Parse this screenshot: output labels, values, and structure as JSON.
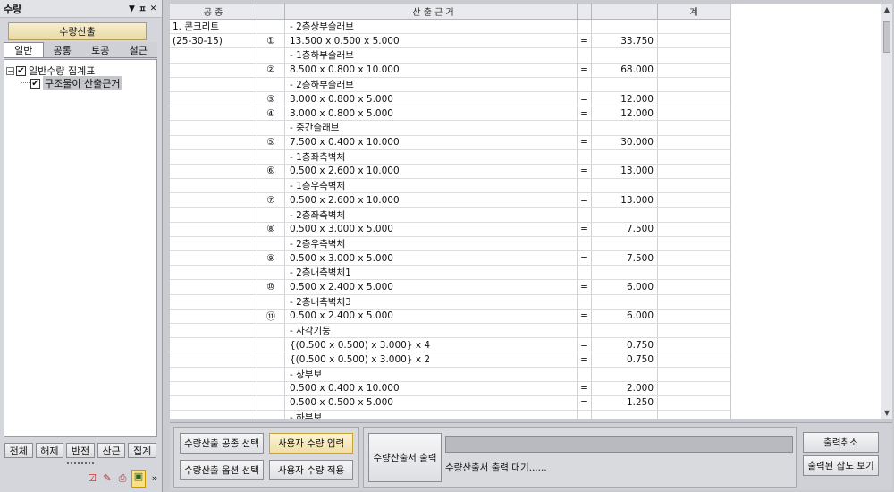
{
  "panel": {
    "title": "수량",
    "controls": [
      "▼",
      "ㅍ",
      "✕"
    ],
    "calc_button": "수량산출",
    "tabs": [
      {
        "label": "일반",
        "active": true
      },
      {
        "label": "공통",
        "active": false
      },
      {
        "label": "토공",
        "active": false
      },
      {
        "label": "철근",
        "active": false
      }
    ],
    "tree": {
      "root": {
        "expander": "−",
        "check": "✔",
        "label": "일반수량 집계표"
      },
      "child": {
        "check": "✔",
        "label": "구조물이 산출근거"
      }
    },
    "filters": [
      "전체",
      "해제",
      "반전",
      "산근",
      "집계"
    ],
    "tools": [
      "☑",
      "✎",
      "⎙",
      "▣",
      "»"
    ]
  },
  "table": {
    "headers": [
      "공 종",
      "",
      "산 출 근 거",
      "",
      "",
      "계"
    ],
    "rows": [
      {
        "c1": "1. 콘크리트",
        "c2": "",
        "c3": "- 2층상부슬래브",
        "c4": "",
        "c5": "",
        "c6": ""
      },
      {
        "c1": "(25-30-15)",
        "c2": "①",
        "c3": "13.500 x 0.500 x 5.000",
        "c4": "=",
        "c5": "33.750",
        "c6": ""
      },
      {
        "c1": "",
        "c2": "",
        "c3": "- 1층하부슬래브",
        "c4": "",
        "c5": "",
        "c6": ""
      },
      {
        "c1": "",
        "c2": "②",
        "c3": "8.500 x 0.800 x 10.000",
        "c4": "=",
        "c5": "68.000",
        "c6": ""
      },
      {
        "c1": "",
        "c2": "",
        "c3": "- 2층하부슬래브",
        "c4": "",
        "c5": "",
        "c6": ""
      },
      {
        "c1": "",
        "c2": "③",
        "c3": "3.000 x 0.800 x 5.000",
        "c4": "=",
        "c5": "12.000",
        "c6": ""
      },
      {
        "c1": "",
        "c2": "④",
        "c3": "3.000 x 0.800 x 5.000",
        "c4": "=",
        "c5": "12.000",
        "c6": ""
      },
      {
        "c1": "",
        "c2": "",
        "c3": "- 중간슬래브",
        "c4": "",
        "c5": "",
        "c6": ""
      },
      {
        "c1": "",
        "c2": "⑤",
        "c3": "7.500 x 0.400 x 10.000",
        "c4": "=",
        "c5": "30.000",
        "c6": ""
      },
      {
        "c1": "",
        "c2": "",
        "c3": "- 1층좌측벽체",
        "c4": "",
        "c5": "",
        "c6": ""
      },
      {
        "c1": "",
        "c2": "⑥",
        "c3": "0.500 x 2.600 x 10.000",
        "c4": "=",
        "c5": "13.000",
        "c6": ""
      },
      {
        "c1": "",
        "c2": "",
        "c3": "- 1층우측벽체",
        "c4": "",
        "c5": "",
        "c6": ""
      },
      {
        "c1": "",
        "c2": "⑦",
        "c3": "0.500 x 2.600 x 10.000",
        "c4": "=",
        "c5": "13.000",
        "c6": ""
      },
      {
        "c1": "",
        "c2": "",
        "c3": "- 2층좌측벽체",
        "c4": "",
        "c5": "",
        "c6": ""
      },
      {
        "c1": "",
        "c2": "⑧",
        "c3": "0.500 x 3.000 x 5.000",
        "c4": "=",
        "c5": "7.500",
        "c6": ""
      },
      {
        "c1": "",
        "c2": "",
        "c3": "- 2층우측벽체",
        "c4": "",
        "c5": "",
        "c6": ""
      },
      {
        "c1": "",
        "c2": "⑨",
        "c3": "0.500 x 3.000 x 5.000",
        "c4": "=",
        "c5": "7.500",
        "c6": ""
      },
      {
        "c1": "",
        "c2": "",
        "c3": "- 2층내측벽체1",
        "c4": "",
        "c5": "",
        "c6": ""
      },
      {
        "c1": "",
        "c2": "⑩",
        "c3": "0.500 x 2.400 x 5.000",
        "c4": "=",
        "c5": "6.000",
        "c6": ""
      },
      {
        "c1": "",
        "c2": "",
        "c3": "- 2층내측벽체3",
        "c4": "",
        "c5": "",
        "c6": ""
      },
      {
        "c1": "",
        "c2": "⑪",
        "c3": "0.500 x 2.400 x 5.000",
        "c4": "=",
        "c5": "6.000",
        "c6": ""
      },
      {
        "c1": "",
        "c2": "",
        "c3": "- 사각기둥",
        "c4": "",
        "c5": "",
        "c6": ""
      },
      {
        "c1": "",
        "c2": "",
        "c3": "{(0.500 x 0.500) x 3.000} x 4",
        "c4": "=",
        "c5": "0.750",
        "c6": ""
      },
      {
        "c1": "",
        "c2": "",
        "c3": "{(0.500 x 0.500) x 3.000} x 2",
        "c4": "=",
        "c5": "0.750",
        "c6": ""
      },
      {
        "c1": "",
        "c2": "",
        "c3": "- 상부보",
        "c4": "",
        "c5": "",
        "c6": ""
      },
      {
        "c1": "",
        "c2": "",
        "c3": "0.500 x 0.400 x 10.000",
        "c4": "=",
        "c5": "2.000",
        "c6": ""
      },
      {
        "c1": "",
        "c2": "",
        "c3": "0.500 x 0.500 x 5.000",
        "c4": "=",
        "c5": "1.250",
        "c6": ""
      },
      {
        "c1": "",
        "c2": "",
        "c3": "- 하부보",
        "c4": "",
        "c5": "",
        "c6": ""
      }
    ]
  },
  "toolbar": {
    "select_work": "수량산출 공종 선택",
    "select_option": "수량산출 옵션 선택",
    "user_input": "사용자 수량 입력",
    "user_apply": "사용자 수량 적용",
    "print": "수량산출서 출력",
    "status": "수량산출서 출력 대기......",
    "progress_percent": 0,
    "cancel_print": "출력취소",
    "view_printed": "출력된 삽도 보기"
  },
  "scroll": {
    "up": "▲",
    "down": "▼"
  }
}
